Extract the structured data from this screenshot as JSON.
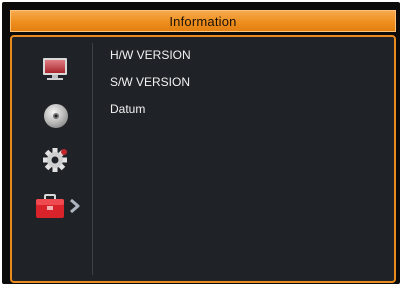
{
  "window": {
    "title": "Information"
  },
  "sidebar": {
    "icons": [
      {
        "name": "tv-icon",
        "label": ""
      },
      {
        "name": "disc-icon",
        "label": ""
      },
      {
        "name": "gear-icon",
        "label": ""
      },
      {
        "name": "toolbox-icon",
        "label": "",
        "selected": true
      }
    ]
  },
  "menu": {
    "items": [
      {
        "label": "H/W VERSION"
      },
      {
        "label": "S/W VERSION"
      },
      {
        "label": "Datum"
      }
    ]
  },
  "colors": {
    "accent": "#ee8f1f",
    "panel_background": "#1f2327",
    "text": "#f2f2f2"
  }
}
